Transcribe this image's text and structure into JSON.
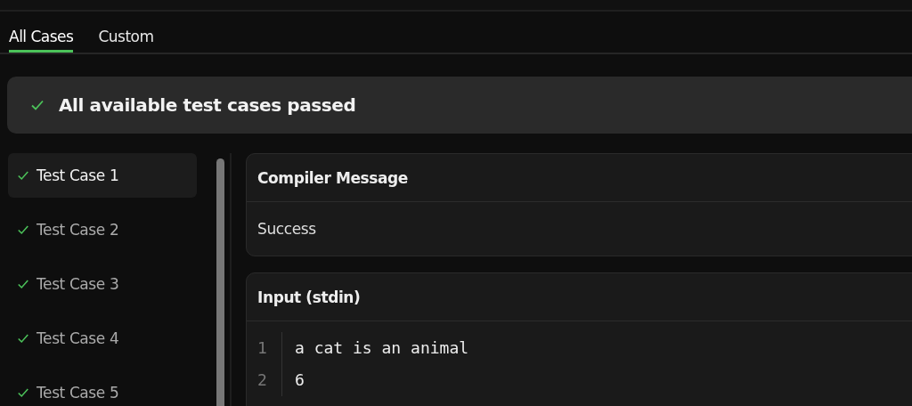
{
  "tabs": [
    {
      "label": "All Cases",
      "selected": true
    },
    {
      "label": "Custom",
      "selected": false
    }
  ],
  "banner": {
    "passed": true,
    "text": "All available test cases passed"
  },
  "test_cases": [
    {
      "label": "Test Case 1",
      "passed": true,
      "selected": true
    },
    {
      "label": "Test Case 2",
      "passed": true,
      "selected": false
    },
    {
      "label": "Test Case 3",
      "passed": true,
      "selected": false
    },
    {
      "label": "Test Case 4",
      "passed": true,
      "selected": false
    },
    {
      "label": "Test Case 5",
      "passed": true,
      "selected": false
    }
  ],
  "compiler_message": {
    "title": "Compiler Message",
    "text": "Success"
  },
  "input": {
    "title": "Input (stdin)",
    "lines": [
      {
        "number": "1",
        "text": "a cat is an animal"
      },
      {
        "number": "2",
        "text": "6"
      }
    ]
  }
}
